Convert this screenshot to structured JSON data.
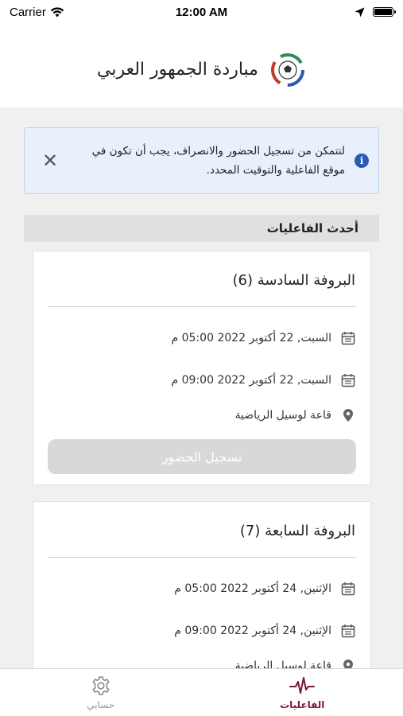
{
  "status_bar": {
    "carrier": "Carrier",
    "time": "12:00 AM"
  },
  "header": {
    "title": "مباردة الجمهور العربي"
  },
  "alert": {
    "line1": "لتتمكن من تسجيل الحضور والانصراف، يجب أن تكون في",
    "line2": "موقع الفاعلية والتوقيت المحدد."
  },
  "section": {
    "title": "أحدث الفاعليات"
  },
  "events": [
    {
      "title": "البروفة السادسة (6)",
      "start": "السبت, 22 أكتوبر 2022 05:00 م",
      "end": "السبت, 22 أكتوبر 2022 09:00 م",
      "location": "قاعة لوسيل الرياضية",
      "button": "تسجيل الحضور"
    },
    {
      "title": "البروفة السابعة (7)",
      "start": "الإثنين, 24 أكتوبر 2022 05:00 م",
      "end": "الإثنين, 24 أكتوبر 2022 09:00 م",
      "location": "قاعة لوسيل الرياضية"
    }
  ],
  "tabs": {
    "account": "حسابي",
    "events": "الفاعليات"
  },
  "colors": {
    "accent": "#7b1734",
    "alert_bg": "#e8f0fb",
    "info": "#2b5bb0"
  }
}
